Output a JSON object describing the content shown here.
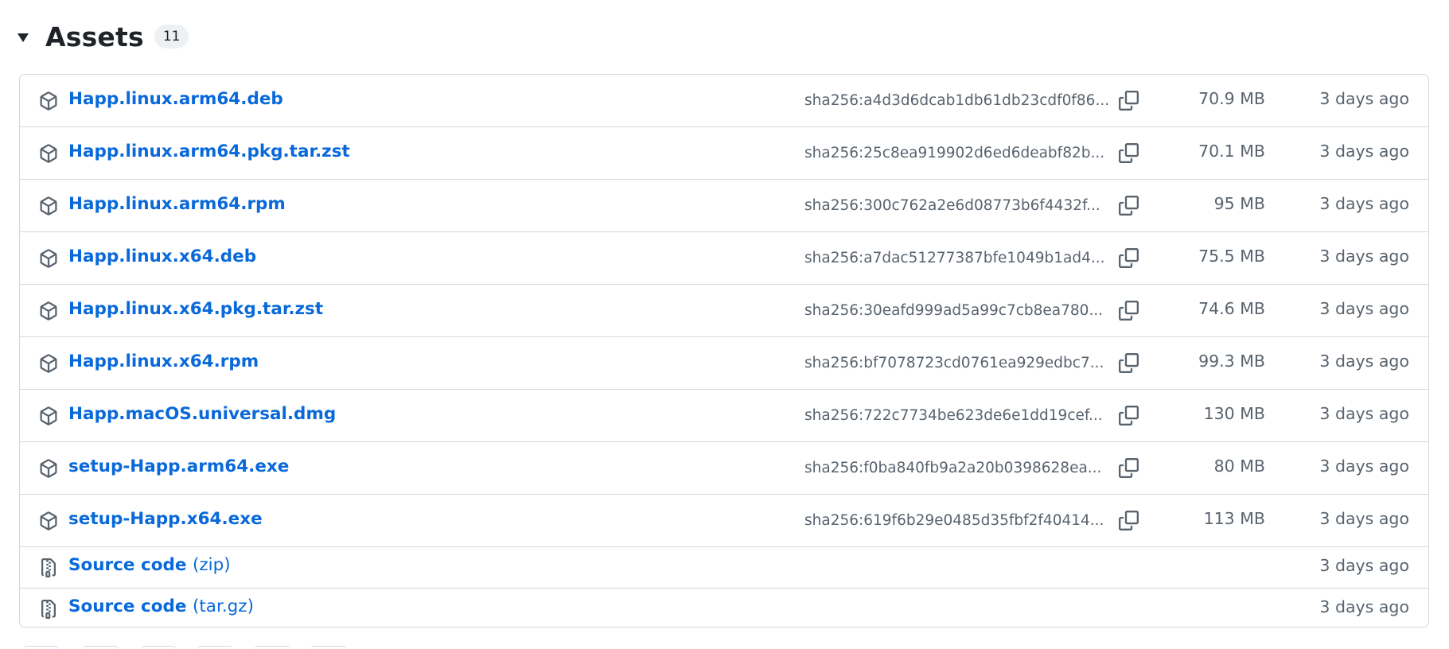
{
  "assets": {
    "title": "Assets",
    "count": "11",
    "files": [
      {
        "name": "Happ.linux.arm64.deb",
        "sha": "sha256:a4d3d6dcab1db61db23cdf0f86...",
        "size": "70.9 MB",
        "date": "3 days ago"
      },
      {
        "name": "Happ.linux.arm64.pkg.tar.zst",
        "sha": "sha256:25c8ea919902d6ed6deabf82b...",
        "size": "70.1 MB",
        "date": "3 days ago"
      },
      {
        "name": "Happ.linux.arm64.rpm",
        "sha": "sha256:300c762a2e6d08773b6f4432f...",
        "size": "95 MB",
        "date": "3 days ago"
      },
      {
        "name": "Happ.linux.x64.deb",
        "sha": "sha256:a7dac51277387bfe1049b1ad4...",
        "size": "75.5 MB",
        "date": "3 days ago"
      },
      {
        "name": "Happ.linux.x64.pkg.tar.zst",
        "sha": "sha256:30eafd999ad5a99c7cb8ea780...",
        "size": "74.6 MB",
        "date": "3 days ago"
      },
      {
        "name": "Happ.linux.x64.rpm",
        "sha": "sha256:bf7078723cd0761ea929edbc7...",
        "size": "99.3 MB",
        "date": "3 days ago"
      },
      {
        "name": "Happ.macOS.universal.dmg",
        "sha": "sha256:722c7734be623de6e1dd19cef...",
        "size": "130 MB",
        "date": "3 days ago"
      },
      {
        "name": "setup-Happ.arm64.exe",
        "sha": "sha256:f0ba840fb9a2a20b0398628ea...",
        "size": "80 MB",
        "date": "3 days ago"
      },
      {
        "name": "setup-Happ.x64.exe",
        "sha": "sha256:619f6b29e0485d35fbf2f40414...",
        "size": "113 MB",
        "date": "3 days ago"
      }
    ],
    "sources": [
      {
        "label": "Source code",
        "suffix": "(zip)",
        "date": "3 days ago"
      },
      {
        "label": "Source code",
        "suffix": "(tar.gz)",
        "date": "3 days ago"
      }
    ]
  },
  "icons": {
    "toggle": "triangle-down-icon",
    "file": "package-icon",
    "copy": "copy-icon",
    "source": "file-zip-icon"
  }
}
